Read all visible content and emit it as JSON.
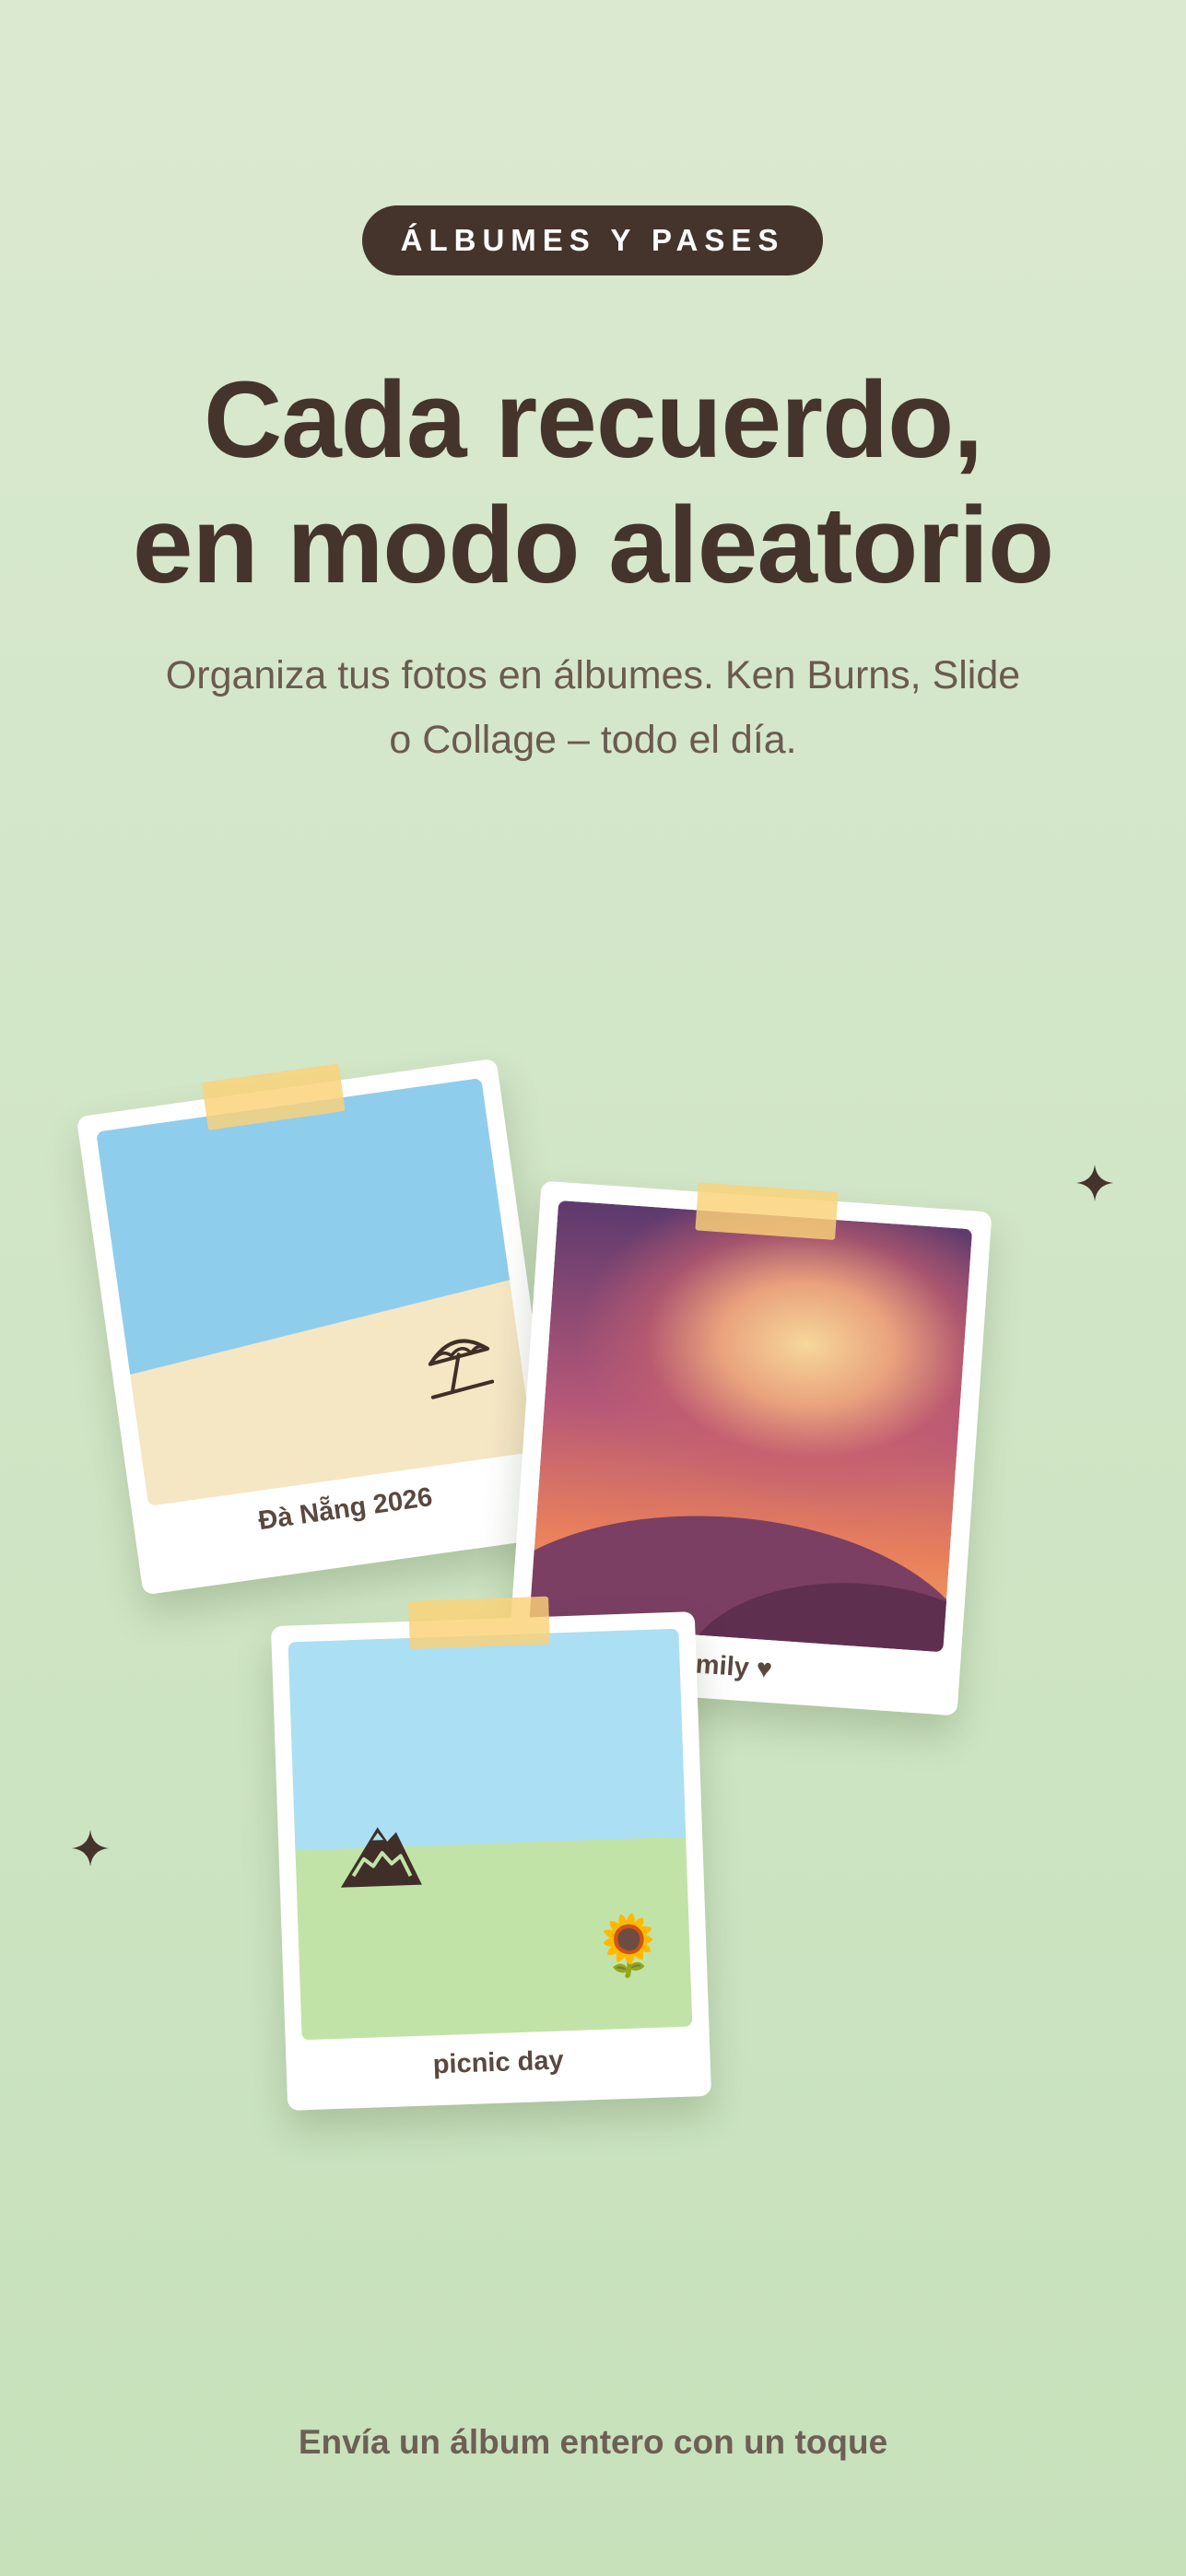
{
  "badge": "ÁLBUMES Y PASES",
  "headline": {
    "line1": "Cada recuerdo,",
    "line2": "en modo aleatorio"
  },
  "subtitle": {
    "line1": "Organiza tus fotos en álbumes. Ken Burns, Slide",
    "line2": "o Collage – todo el día."
  },
  "polaroids": [
    {
      "caption": "Đà Nẵng 2026",
      "icon": "beach-umbrella-icon"
    },
    {
      "caption": "mily ♥",
      "icon": "sunset-hills"
    },
    {
      "caption": "picnic day",
      "icon": "mountain-icon",
      "emoji": "🌻"
    }
  ],
  "footer": "Envía un álbum entero con un toque",
  "colors": {
    "background": "#d2e6c8",
    "badge": "#45342b",
    "headline": "#45342b",
    "tape": "#fad278"
  }
}
